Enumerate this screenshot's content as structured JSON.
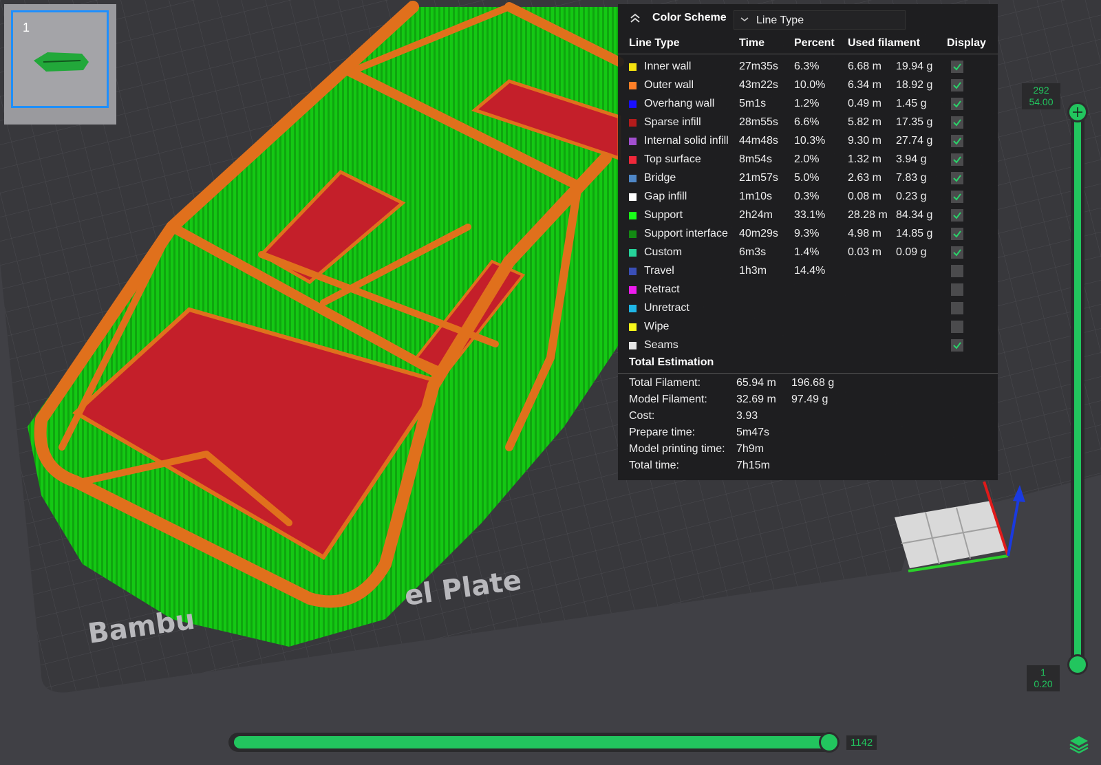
{
  "thumbnail": {
    "plate_number": "1"
  },
  "color_scheme": {
    "title": "Color Scheme",
    "selected": "Line Type",
    "headers": {
      "line_type": "Line Type",
      "time": "Time",
      "percent": "Percent",
      "used_filament": "Used filament",
      "display": "Display"
    },
    "rows": [
      {
        "label": "Inner wall",
        "time": "27m35s",
        "percent": "6.3%",
        "length": "6.68 m",
        "weight": "19.94 g",
        "color": "#f5e20f",
        "checked": true
      },
      {
        "label": "Outer wall",
        "time": "43m22s",
        "percent": "10.0%",
        "length": "6.34 m",
        "weight": "18.92 g",
        "color": "#ff7f27",
        "checked": true
      },
      {
        "label": "Overhang wall",
        "time": "5m1s",
        "percent": "1.2%",
        "length": "0.49 m",
        "weight": "1.45 g",
        "color": "#1a10ff",
        "checked": true
      },
      {
        "label": "Sparse infill",
        "time": "28m55s",
        "percent": "6.6%",
        "length": "5.82 m",
        "weight": "17.35 g",
        "color": "#b31b1b",
        "checked": true
      },
      {
        "label": "Internal solid infill",
        "time": "44m48s",
        "percent": "10.3%",
        "length": "9.30 m",
        "weight": "27.74 g",
        "color": "#a24fcf",
        "checked": true
      },
      {
        "label": "Top surface",
        "time": "8m54s",
        "percent": "2.0%",
        "length": "1.32 m",
        "weight": "3.94 g",
        "color": "#f0283a",
        "checked": true
      },
      {
        "label": "Bridge",
        "time": "21m57s",
        "percent": "5.0%",
        "length": "2.63 m",
        "weight": "7.83 g",
        "color": "#4f87c7",
        "checked": true
      },
      {
        "label": "Gap infill",
        "time": "1m10s",
        "percent": "0.3%",
        "length": "0.08 m",
        "weight": "0.23 g",
        "color": "#ffffff",
        "checked": true
      },
      {
        "label": "Support",
        "time": "2h24m",
        "percent": "33.1%",
        "length": "28.28 m",
        "weight": "84.34 g",
        "color": "#19ff19",
        "checked": true
      },
      {
        "label": "Support interface",
        "time": "40m29s",
        "percent": "9.3%",
        "length": "4.98 m",
        "weight": "14.85 g",
        "color": "#138a13",
        "checked": true
      },
      {
        "label": "Custom",
        "time": "6m3s",
        "percent": "1.4%",
        "length": "0.03 m",
        "weight": "0.09 g",
        "color": "#26d39a",
        "checked": true
      },
      {
        "label": "Travel",
        "time": "1h3m",
        "percent": "14.4%",
        "length": "",
        "weight": "",
        "color": "#3a4fb7",
        "checked": false
      },
      {
        "label": "Retract",
        "time": "",
        "percent": "",
        "length": "",
        "weight": "",
        "color": "#ee1bee",
        "checked": false
      },
      {
        "label": "Unretract",
        "time": "",
        "percent": "",
        "length": "",
        "weight": "",
        "color": "#1fb6e6",
        "checked": false
      },
      {
        "label": "Wipe",
        "time": "",
        "percent": "",
        "length": "",
        "weight": "",
        "color": "#f7f71a",
        "checked": false
      },
      {
        "label": "Seams",
        "time": "",
        "percent": "",
        "length": "",
        "weight": "",
        "color": "#e6e6e6",
        "checked": true
      }
    ]
  },
  "total_estimation": {
    "title": "Total Estimation",
    "rows": [
      {
        "label": "Total Filament:",
        "v1": "65.94 m",
        "v2": "196.68 g"
      },
      {
        "label": "Model Filament:",
        "v1": "32.69 m",
        "v2": "97.49 g"
      },
      {
        "label": "Cost:",
        "v1": "3.93",
        "v2": ""
      },
      {
        "label": "Prepare time:",
        "v1": "5m47s",
        "v2": ""
      },
      {
        "label": "Model printing time:",
        "v1": "7h9m",
        "v2": ""
      },
      {
        "label": "Total time:",
        "v1": "7h15m",
        "v2": ""
      }
    ]
  },
  "plate": {
    "text_left": "Bambu",
    "text_right": "el Plate"
  },
  "layer_slider": {
    "top_layer": "292",
    "top_height": "54.00",
    "bottom_layer": "1",
    "bottom_height": "0.20"
  },
  "move_slider": {
    "value": "1142"
  },
  "colors": {
    "accent": "#22c55e",
    "support": "#19ff19",
    "wall": "#e0701c",
    "infill": "#c41f2a"
  }
}
